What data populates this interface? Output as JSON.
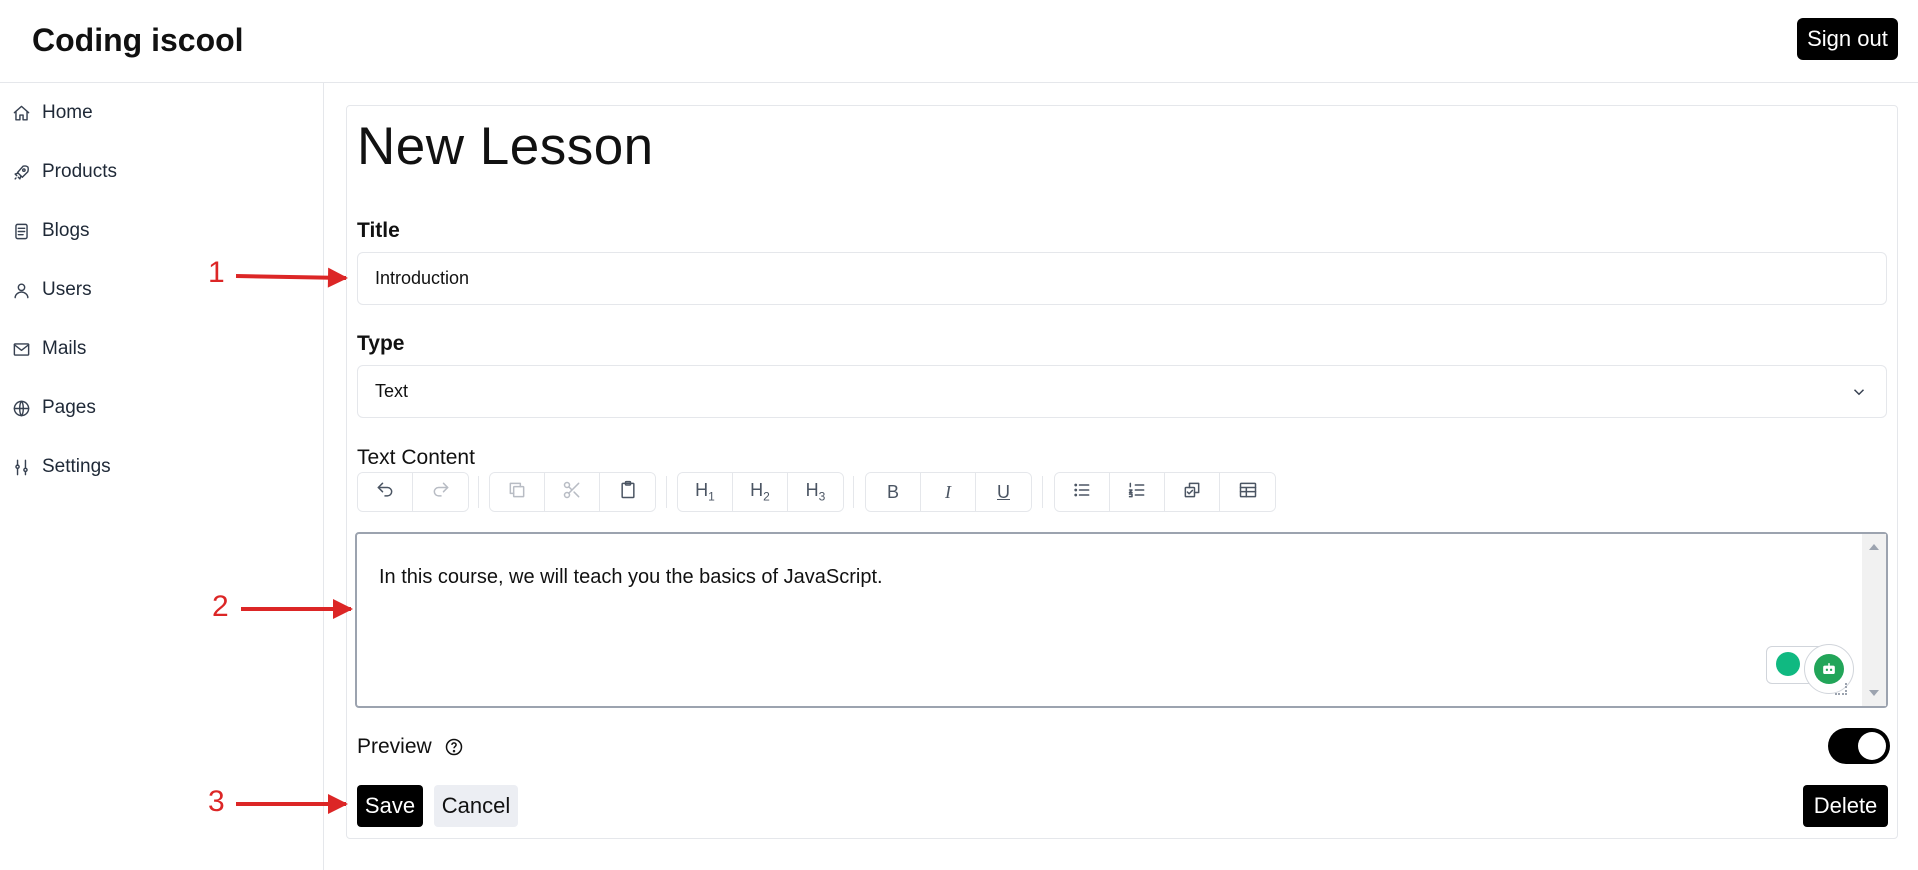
{
  "header": {
    "brand": "Coding iscool",
    "signout_label": "Sign out"
  },
  "sidebar": {
    "items": [
      {
        "label": "Home",
        "icon": "home-icon"
      },
      {
        "label": "Products",
        "icon": "rocket-icon"
      },
      {
        "label": "Blogs",
        "icon": "document-icon"
      },
      {
        "label": "Users",
        "icon": "user-icon"
      },
      {
        "label": "Mails",
        "icon": "mail-icon"
      },
      {
        "label": "Pages",
        "icon": "globe-icon"
      },
      {
        "label": "Settings",
        "icon": "sliders-icon"
      }
    ]
  },
  "form": {
    "page_title": "New Lesson",
    "title_label": "Title",
    "title_value": "Introduction",
    "type_label": "Type",
    "type_value": "Text",
    "content_label": "Text Content",
    "content_value": "In this course, we will teach you the basics of JavaScript.",
    "toolbar": {
      "h1": "H",
      "h1_sub": "1",
      "h2": "H",
      "h2_sub": "2",
      "h3": "H",
      "h3_sub": "3",
      "bold": "B",
      "italic": "I",
      "underline": "U"
    },
    "preview_label": "Preview",
    "preview_on": true,
    "save_label": "Save",
    "cancel_label": "Cancel",
    "delete_label": "Delete"
  },
  "annotations": {
    "n1": "1",
    "n2": "2",
    "n3": "3"
  },
  "colors": {
    "annotation": "#dc2626",
    "primary": "#000000",
    "toggle_on": "#000000",
    "extension_green": "#22a559"
  }
}
